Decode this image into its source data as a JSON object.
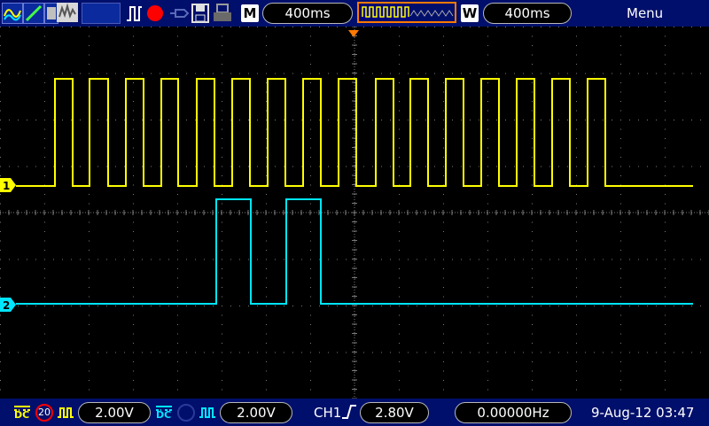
{
  "toolbar": {
    "timebase_tag": "M",
    "timebase_value": "400ms",
    "window_tag": "W",
    "window_value": "400ms",
    "menu_label": "Menu"
  },
  "bottom": {
    "ch1_coupling": "DC",
    "ch1_bw_limit": "20",
    "ch1_scale": "2.00V",
    "ch2_coupling": "DC",
    "ch2_scale": "2.00V",
    "trigger_source": "CH1",
    "trigger_level": "2.80V",
    "frequency": "0.00000Hz",
    "datetime": "9-Aug-12 03:47"
  },
  "channels": [
    {
      "marker": "1",
      "color": "#ffff00"
    },
    {
      "marker": "2",
      "color": "#00e5ff"
    }
  ],
  "waveforms": {
    "ch1_transitions": [
      62,
      82,
      101,
      122,
      142,
      162,
      182,
      201,
      222,
      242,
      262,
      282,
      302,
      322,
      342,
      362,
      382,
      402,
      424,
      444,
      463,
      483,
      503,
      523,
      543,
      563,
      583,
      603,
      623,
      643,
      663,
      683
    ],
    "ch2_transitions": [
      244,
      283,
      323,
      362
    ]
  },
  "colors": {
    "background": "#000f6b",
    "screen": "#000000",
    "grid": "#7a7a7a",
    "trigger_marker": "#ff7a00",
    "record_indicator": "#ff0000"
  }
}
